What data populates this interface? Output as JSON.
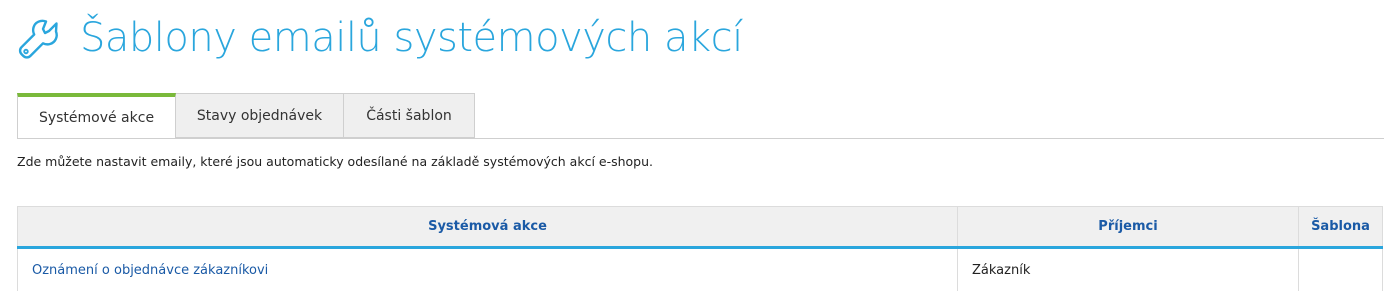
{
  "header": {
    "title": "Šablony emailů systémových akcí",
    "icon": "wrench-icon",
    "accent_color": "#2aa6dd"
  },
  "tabs": [
    {
      "label": "Systémové akce",
      "active": true
    },
    {
      "label": "Stavy objednávek",
      "active": false
    },
    {
      "label": "Části šablon",
      "active": false
    }
  ],
  "intro_text": "Zde můžete nastavit emaily, které jsou automaticky odesílané na základě systémových akcí e-shopu.",
  "table": {
    "columns": [
      "Systémová akce",
      "Příjemci",
      "Šablona"
    ],
    "rows": [
      {
        "action": "Oznámení o objednávce zákazníkovi",
        "recipients": "Zákazník",
        "template": ""
      }
    ]
  },
  "colors": {
    "active_tab": "#7ab93a",
    "header_underline": "#2aa6dd",
    "link": "#1a5aa6"
  }
}
